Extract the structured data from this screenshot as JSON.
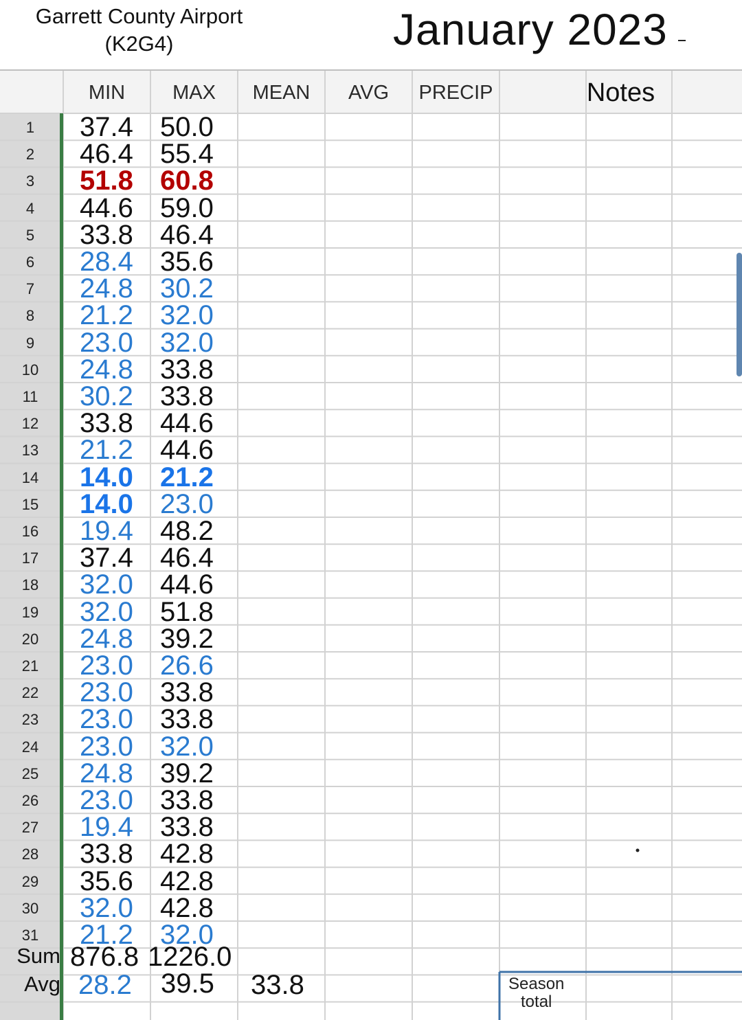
{
  "station": {
    "line1": "Garrett County Airport",
    "line2": "(K2G4)"
  },
  "month": "January 2023",
  "columns": [
    "MIN",
    "MAX",
    "MEAN",
    "AVG",
    "PRECIP",
    "Notes"
  ],
  "rows": [
    {
      "day": "1",
      "min": "37.4",
      "max": "50.0",
      "min_style": "black",
      "max_style": "black"
    },
    {
      "day": "2",
      "min": "46.4",
      "max": "55.4",
      "min_style": "black",
      "max_style": "black"
    },
    {
      "day": "3",
      "min": "51.8",
      "max": "60.8",
      "min_style": "bold-red",
      "max_style": "bold-red"
    },
    {
      "day": "4",
      "min": "44.6",
      "max": "59.0",
      "min_style": "black",
      "max_style": "black"
    },
    {
      "day": "5",
      "min": "33.8",
      "max": "46.4",
      "min_style": "black",
      "max_style": "black"
    },
    {
      "day": "6",
      "min": "28.4",
      "max": "35.6",
      "min_style": "blue",
      "max_style": "black"
    },
    {
      "day": "7",
      "min": "24.8",
      "max": "30.2",
      "min_style": "blue",
      "max_style": "blue"
    },
    {
      "day": "8",
      "min": "21.2",
      "max": "32.0",
      "min_style": "blue",
      "max_style": "blue"
    },
    {
      "day": "9",
      "min": "23.0",
      "max": "32.0",
      "min_style": "blue",
      "max_style": "blue"
    },
    {
      "day": "10",
      "min": "24.8",
      "max": "33.8",
      "min_style": "blue",
      "max_style": "black"
    },
    {
      "day": "11",
      "min": "30.2",
      "max": "33.8",
      "min_style": "blue",
      "max_style": "black"
    },
    {
      "day": "12",
      "min": "33.8",
      "max": "44.6",
      "min_style": "black",
      "max_style": "black"
    },
    {
      "day": "13",
      "min": "21.2",
      "max": "44.6",
      "min_style": "blue",
      "max_style": "black"
    },
    {
      "day": "14",
      "min": "14.0",
      "max": "21.2",
      "min_style": "bold-blue",
      "max_style": "bold-blue"
    },
    {
      "day": "15",
      "min": "14.0",
      "max": "23.0",
      "min_style": "bold-blue",
      "max_style": "blue"
    },
    {
      "day": "16",
      "min": "19.4",
      "max": "48.2",
      "min_style": "blue",
      "max_style": "black"
    },
    {
      "day": "17",
      "min": "37.4",
      "max": "46.4",
      "min_style": "black",
      "max_style": "black"
    },
    {
      "day": "18",
      "min": "32.0",
      "max": "44.6",
      "min_style": "blue",
      "max_style": "black"
    },
    {
      "day": "19",
      "min": "32.0",
      "max": "51.8",
      "min_style": "blue",
      "max_style": "black"
    },
    {
      "day": "20",
      "min": "24.8",
      "max": "39.2",
      "min_style": "blue",
      "max_style": "black"
    },
    {
      "day": "21",
      "min": "23.0",
      "max": "26.6",
      "min_style": "blue",
      "max_style": "blue"
    },
    {
      "day": "22",
      "min": "23.0",
      "max": "33.8",
      "min_style": "blue",
      "max_style": "black"
    },
    {
      "day": "23",
      "min": "23.0",
      "max": "33.8",
      "min_style": "blue",
      "max_style": "black"
    },
    {
      "day": "24",
      "min": "23.0",
      "max": "32.0",
      "min_style": "blue",
      "max_style": "blue"
    },
    {
      "day": "25",
      "min": "24.8",
      "max": "39.2",
      "min_style": "blue",
      "max_style": "black"
    },
    {
      "day": "26",
      "min": "23.0",
      "max": "33.8",
      "min_style": "blue",
      "max_style": "black"
    },
    {
      "day": "27",
      "min": "19.4",
      "max": "33.8",
      "min_style": "blue",
      "max_style": "black"
    },
    {
      "day": "28",
      "min": "33.8",
      "max": "42.8",
      "min_style": "black",
      "max_style": "black"
    },
    {
      "day": "29",
      "min": "35.6",
      "max": "42.8",
      "min_style": "black",
      "max_style": "black"
    },
    {
      "day": "30",
      "min": "32.0",
      "max": "42.8",
      "min_style": "blue",
      "max_style": "black"
    },
    {
      "day": "31",
      "min": "21.2",
      "max": "32.0",
      "min_style": "blue",
      "max_style": "blue"
    }
  ],
  "sum": {
    "label": "Sum",
    "min": "876.8",
    "max": "1226.0"
  },
  "avg": {
    "label": "Avg",
    "min": "28.2",
    "max": "39.5",
    "mean": "33.8",
    "min_style": "blue"
  },
  "season_total": {
    "line1": "Season",
    "line2": "total"
  },
  "colors": {
    "cold_blue": "#2a7bd0",
    "record_red": "#b30000",
    "record_blue": "#1a74e8",
    "freeze_bar": "#3a7d44"
  }
}
